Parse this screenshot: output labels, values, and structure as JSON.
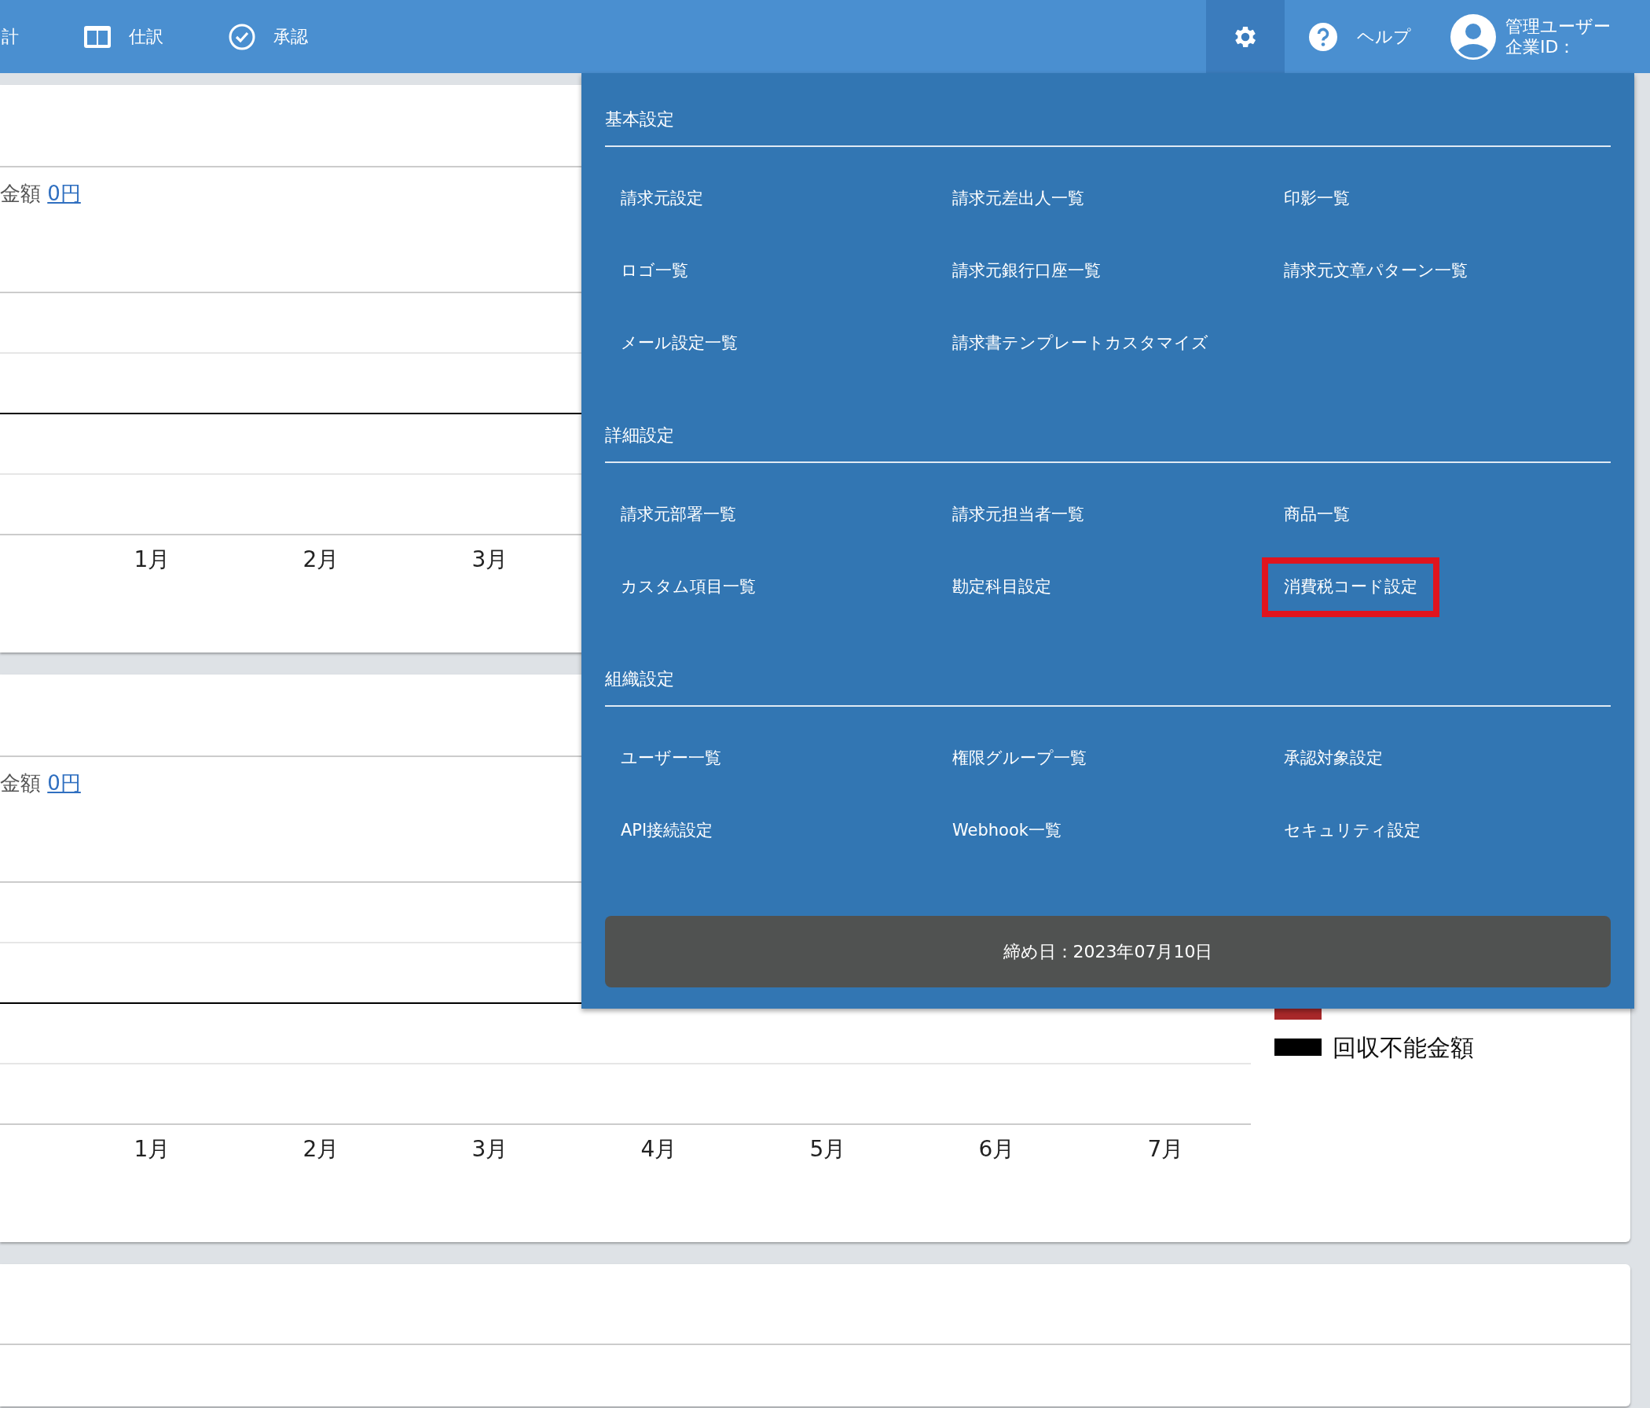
{
  "navbar": {
    "nav_items": [
      {
        "label": "計"
      },
      {
        "label": "仕訳"
      },
      {
        "label": "承認"
      }
    ],
    "settings": {
      "open": true
    },
    "help": {
      "label": "ヘルプ"
    },
    "user": {
      "name": "管理ユーザー",
      "company_id": "企業ID："
    }
  },
  "cards": [
    {
      "summary_label": "金額",
      "summary_value": "0円",
      "month_labels": [
        "1月",
        "2月",
        "3月"
      ]
    },
    {
      "summary_label": "金額",
      "summary_value": "0円",
      "month_labels": [
        "1月",
        "2月",
        "3月",
        "4月",
        "5月",
        "6月",
        "7月"
      ],
      "legend": [
        {
          "color": "#a8282a"
        },
        {
          "label": "回収不能金額",
          "color": "#000000"
        }
      ]
    }
  ],
  "settings_menu": {
    "sections": [
      {
        "title": "基本設定",
        "items": [
          {
            "label": "請求元設定",
            "highlighted": false
          },
          {
            "label": "請求元差出人一覧",
            "highlighted": false
          },
          {
            "label": "印影一覧",
            "highlighted": false
          },
          {
            "label": "ロゴ一覧",
            "highlighted": false
          },
          {
            "label": "請求元銀行口座一覧",
            "highlighted": false
          },
          {
            "label": "請求元文章パターン一覧",
            "highlighted": false
          },
          {
            "label": "メール設定一覧",
            "highlighted": false
          },
          {
            "label": "請求書テンプレートカスタマイズ",
            "highlighted": false
          }
        ]
      },
      {
        "title": "詳細設定",
        "items": [
          {
            "label": "請求元部署一覧",
            "highlighted": false
          },
          {
            "label": "請求元担当者一覧",
            "highlighted": false
          },
          {
            "label": "商品一覧",
            "highlighted": false
          },
          {
            "label": "カスタム項目一覧",
            "highlighted": false
          },
          {
            "label": "勘定科目設定",
            "highlighted": false
          },
          {
            "label": "消費税コード設定",
            "highlighted": true
          }
        ]
      },
      {
        "title": "組織設定",
        "items": [
          {
            "label": "ユーザー一覧",
            "highlighted": false
          },
          {
            "label": "権限グループ一覧",
            "highlighted": false
          },
          {
            "label": "承認対象設定",
            "highlighted": false
          },
          {
            "label": "API接続設定",
            "highlighted": false
          },
          {
            "label": "Webhook一覧",
            "highlighted": false
          },
          {
            "label": "セキュリティ設定",
            "highlighted": false
          }
        ]
      }
    ],
    "closing_date": "締め日：2023年07月10日"
  }
}
